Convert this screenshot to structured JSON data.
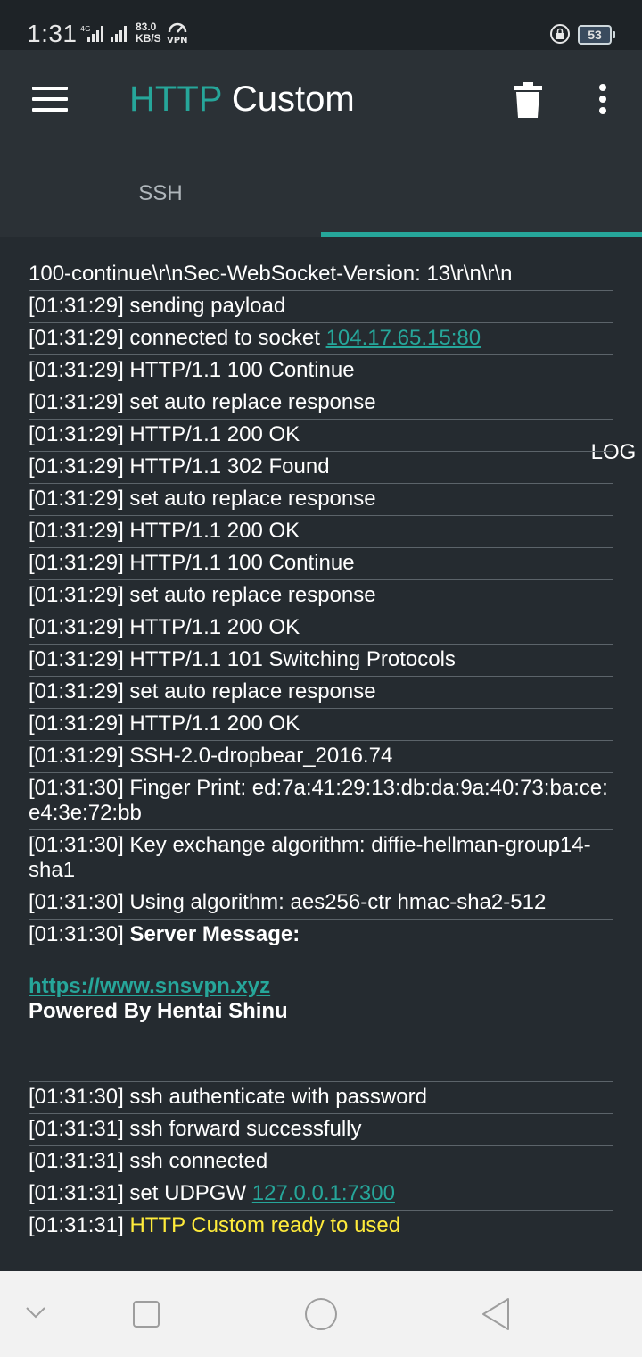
{
  "status_bar": {
    "time": "1:31",
    "network_type": "4G",
    "speed_value": "83.0",
    "speed_unit": "KB/S",
    "vpn_label": "VPN",
    "battery": "53"
  },
  "app_bar": {
    "title_accent": "HTTP",
    "title_rest": " Custom",
    "icons": [
      "menu-icon",
      "trash-icon",
      "more-vert-icon"
    ]
  },
  "tabs": [
    {
      "label": "SSH",
      "selected": false
    },
    {
      "label": "LOG",
      "selected": true
    }
  ],
  "colors": {
    "accent": "#26a69a",
    "background": "#252b30",
    "highlight_text": "#ffeb3b"
  },
  "log": {
    "line0": "100-continue\\r\\nSec-WebSocket-Version: 13\\r\\n\\r\\n",
    "line1": "[01:31:29] sending payload",
    "line2_prefix": "[01:31:29] connected to socket ",
    "line2_link": "104.17.65.15:80",
    "line3": "[01:31:29] HTTP/1.1 100 Continue",
    "line4": "[01:31:29] set auto replace response",
    "line5": "[01:31:29] HTTP/1.1 200 OK",
    "line6": "[01:31:29] HTTP/1.1 302 Found",
    "line7": "[01:31:29] set auto replace response",
    "line8": "[01:31:29] HTTP/1.1 200 OK",
    "line9": "[01:31:29] HTTP/1.1 100 Continue",
    "line10": "[01:31:29] set auto replace response",
    "line11": "[01:31:29] HTTP/1.1 200 OK",
    "line12": "[01:31:29] HTTP/1.1 101 Switching Protocols",
    "line13": "[01:31:29] set auto replace response",
    "line14": "[01:31:29] HTTP/1.1 200 OK",
    "line15": "[01:31:29] SSH-2.0-dropbear_2016.74",
    "line16": "[01:31:30] Finger Print: ed:7a:41:29:13:db:da:9a:40:73:ba:ce:e4:3e:72:bb",
    "line17": "[01:31:30] Key exchange algorithm: diffie-hellman-group14-sha1",
    "line18": "[01:31:30] Using algorithm: aes256-ctr hmac-sha2-512",
    "line19_prefix": "[01:31:30] ",
    "line19_bold": "Server Message:",
    "server_link": "https://www.snsvpn.xyz",
    "server_powered": "Powered By Hentai Shinu",
    "line20": "[01:31:30] ssh authenticate with password",
    "line21": "[01:31:31] ssh forward successfully",
    "line22": "[01:31:31] ssh connected",
    "line23_prefix": "[01:31:31] set UDPGW ",
    "line23_link": "127.0.0.1:7300",
    "line24_prefix": "[01:31:31] ",
    "line24_highlight": "HTTP Custom ready to used"
  },
  "nav_bar": {
    "icons": [
      "chevron-down-icon",
      "recents-square-icon",
      "home-circle-icon",
      "back-triangle-icon"
    ]
  }
}
